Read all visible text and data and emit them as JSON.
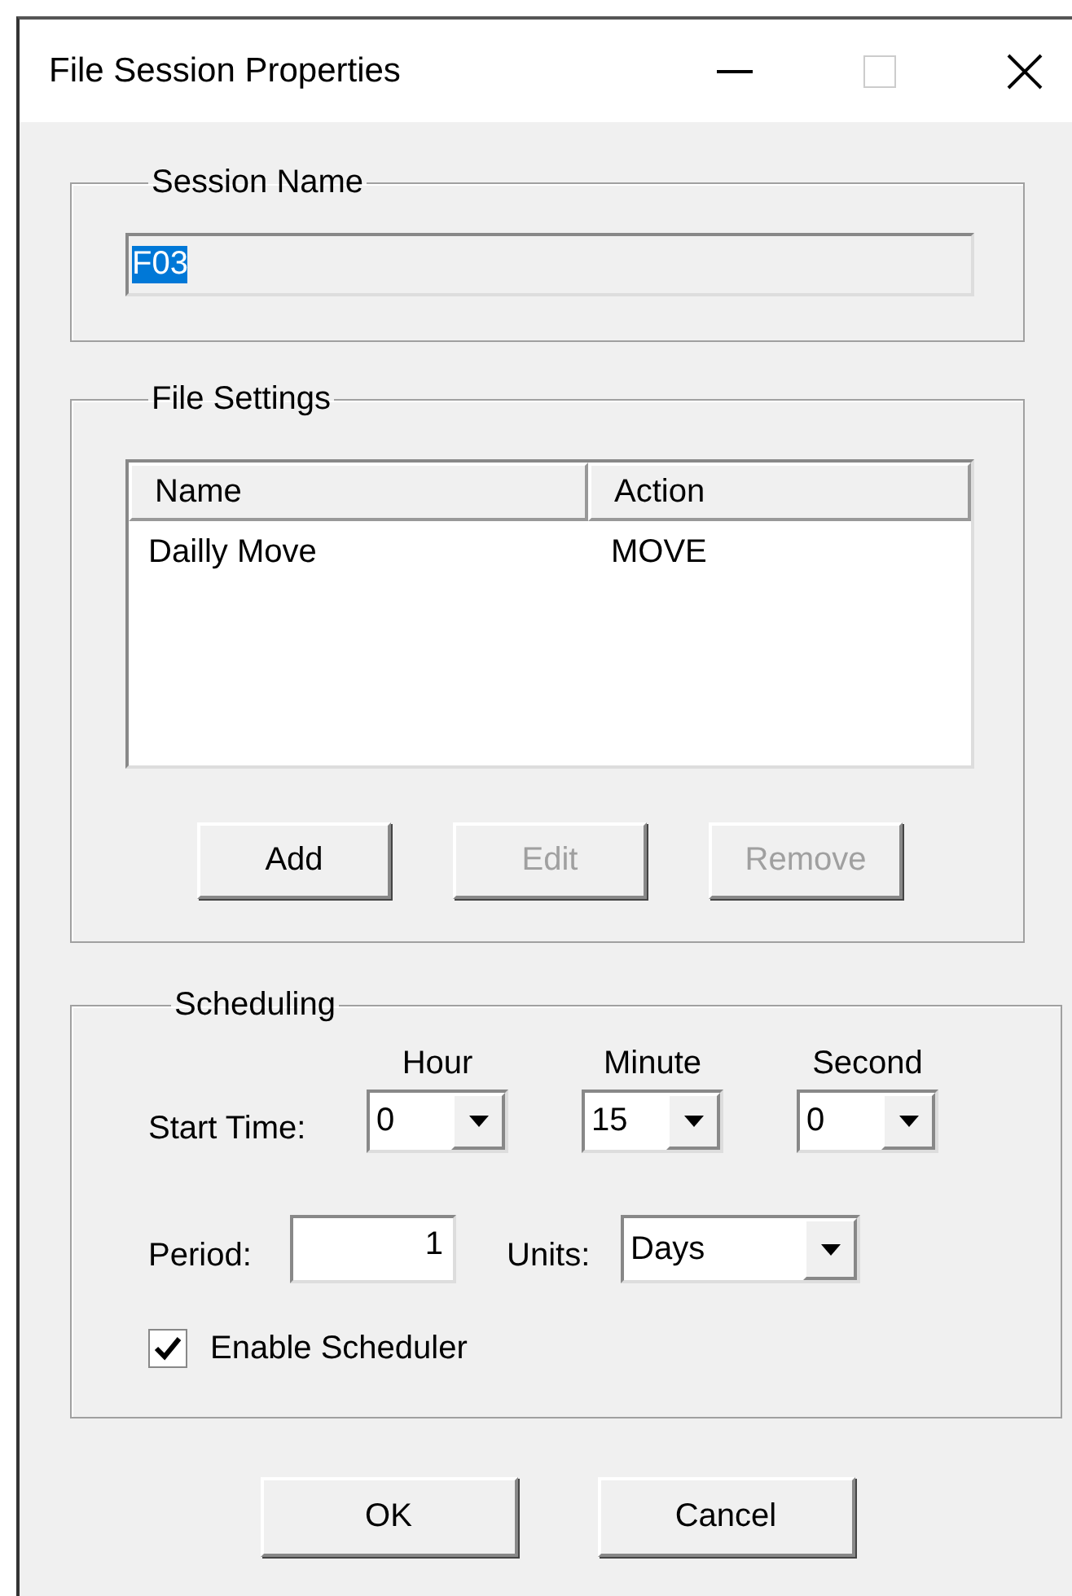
{
  "window": {
    "title": "File Session Properties"
  },
  "session_name": {
    "label": "Session Name",
    "value": "F03",
    "selected": true
  },
  "file_settings": {
    "label": "File Settings",
    "columns": [
      "Name",
      "Action"
    ],
    "rows": [
      {
        "cells": [
          "Dailly Move",
          "MOVE"
        ]
      }
    ],
    "buttons": [
      {
        "label": "Add",
        "disabled": false
      },
      {
        "label": "Edit",
        "disabled": true
      },
      {
        "label": "Remove",
        "disabled": true
      }
    ]
  },
  "scheduling": {
    "label": "Scheduling",
    "start_time_label": "Start Time:",
    "time_fields": [
      {
        "label": "Hour",
        "value": "0"
      },
      {
        "label": "Minute",
        "value": "15"
      },
      {
        "label": "Second",
        "value": "0"
      }
    ],
    "period_label": "Period:",
    "period_value": "1",
    "units_label": "Units:",
    "units_value": "Days",
    "enable": {
      "label": "Enable Scheduler",
      "checked": true
    }
  },
  "buttons": [
    {
      "label": "OK"
    },
    {
      "label": "Cancel"
    }
  ]
}
